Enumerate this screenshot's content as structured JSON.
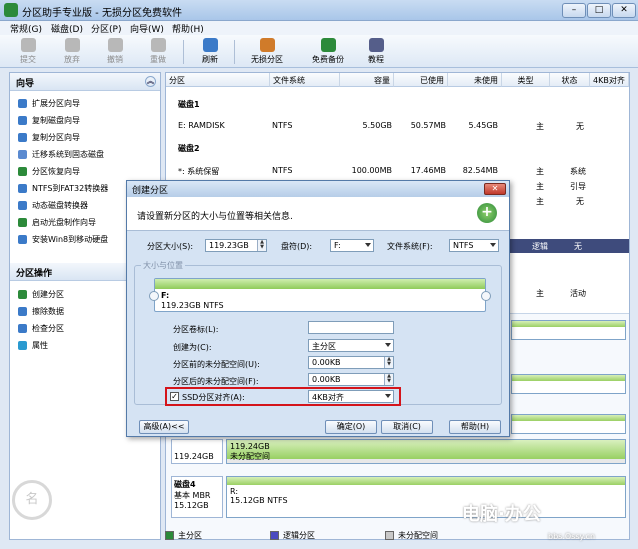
{
  "window": {
    "title": "分区助手专业版 - 无损分区免费软件",
    "minimize": "–",
    "restore": "□",
    "close": "✕"
  },
  "menu": [
    "常规(G)",
    "磁盘(D)",
    "分区(P)",
    "向导(W)",
    "帮助(H)"
  ],
  "toolbar": [
    {
      "label": "提交",
      "icon": "commit-icon",
      "enabled": false
    },
    {
      "label": "放弃",
      "icon": "discard-icon",
      "enabled": false
    },
    {
      "label": "撤销",
      "icon": "undo-icon",
      "enabled": false
    },
    {
      "label": "重做",
      "icon": "redo-icon",
      "enabled": false
    },
    {
      "label": "刷新",
      "icon": "refresh-icon",
      "enabled": true
    },
    {
      "label": "无损分区",
      "icon": "lossless-partition-icon",
      "enabled": true
    },
    {
      "label": "免费备份",
      "icon": "free-backup-icon",
      "enabled": true
    },
    {
      "label": "教程",
      "icon": "tutorial-icon",
      "enabled": true
    }
  ],
  "sidebar": {
    "wizard_title": "向导",
    "wizard_items": [
      "扩展分区向导",
      "复制磁盘向导",
      "复制分区向导",
      "迁移系统到固态磁盘",
      "分区恢复向导",
      "NTFS到FAT32转换器",
      "动态磁盘转换器",
      "启动光盘制作向导",
      "安装Win8到移动硬盘"
    ],
    "ops_title": "分区操作",
    "ops_items": [
      "创建分区",
      "擦除数据",
      "检查分区",
      "属性"
    ],
    "logo_text": "名"
  },
  "table": {
    "columns": [
      "分区",
      "文件系统",
      "容量",
      "已使用",
      "未使用",
      "类型",
      "状态",
      "4KB对齐"
    ],
    "disk1_label": "磁盘1",
    "disk1_rows": [
      {
        "name": "E: RAMDISK",
        "fs": "NTFS",
        "cap": "5.50GB",
        "used": "50.57MB",
        "free": "5.45GB",
        "type": "主",
        "status": "无"
      }
    ],
    "disk2_label": "磁盘2",
    "disk2_rows": [
      {
        "name": "*: 系统保留",
        "fs": "NTFS",
        "cap": "100.00MB",
        "used": "17.46MB",
        "free": "82.54MB",
        "type": "主",
        "status": "系统"
      }
    ],
    "partial_rows": [
      {
        "type": "主",
        "status": "引导"
      },
      {
        "type": "主",
        "status": "无"
      },
      {
        "type": "逻辑",
        "status": "无"
      },
      {
        "type": "主",
        "status": "活动"
      }
    ]
  },
  "diskmap": {
    "unalloc_size": "119.24GB",
    "unalloc_bar_size": "119.24GB",
    "unalloc_bar_label": "未分配空间",
    "disk4_name": "磁盘4",
    "disk4_type": "基本 MBR",
    "disk4_size": "15.12GB",
    "disk4_part_name": "R:",
    "disk4_part_info": "15.12GB NTFS"
  },
  "legend": {
    "primary": "主分区",
    "logical": "逻辑分区",
    "unalloc": "未分配空间"
  },
  "colors": {
    "primary": "#2c8a3a",
    "logical": "#4a4ac0",
    "unalloc": "#c8c8c8",
    "accent_red": "#d4141a",
    "bar_green": "#8fcb5a"
  },
  "dialog": {
    "title": "创建分区",
    "close": "✕",
    "description": "请设置新分区的大小与位置等相关信息.",
    "size_label": "分区大小(S):",
    "size_value": "119.23GB",
    "drive_label": "盘符(D):",
    "drive_value": "F:",
    "fs_label": "文件系统(F):",
    "fs_value": "NTFS",
    "group_title": "大小与位置",
    "bar_drive": "F:",
    "bar_info": "119.23GB NTFS",
    "volume_label": "分区卷标(L):",
    "volume_value": "",
    "create_as_label": "创建为(C):",
    "create_as_value": "主分区",
    "before_label": "分区前的未分配空间(U):",
    "before_value": "0.00KB",
    "after_label": "分区后的未分配空间(F):",
    "after_value": "0.00KB",
    "ssd_label": "SSD分区对齐(A):",
    "ssd_value": "4KB对齐",
    "ssd_checked": "✓",
    "advanced_button": "高级(A)<<",
    "ok_button": "确定(O)",
    "cancel_button": "取消(C)",
    "help_button": "帮助(H)"
  },
  "watermark": {
    "brand": "电脑·办公",
    "site": "bbs.Ossy.cn"
  }
}
